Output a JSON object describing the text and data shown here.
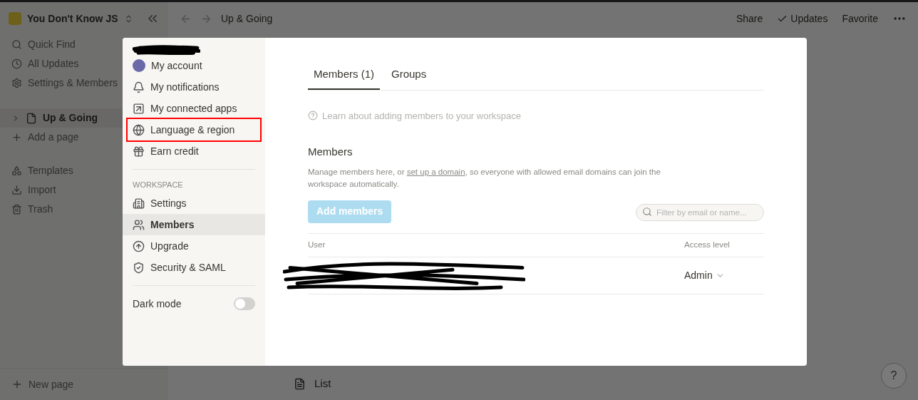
{
  "workspace": {
    "name": "You Don't Know JS"
  },
  "sidebar": {
    "nav": [
      {
        "label": "Quick Find"
      },
      {
        "label": "All Updates"
      },
      {
        "label": "Settings & Members"
      }
    ],
    "pages": [
      {
        "label": "Up & Going",
        "selected": true
      },
      {
        "label": "Add a page",
        "selected": false
      }
    ],
    "tools": [
      {
        "label": "Templates"
      },
      {
        "label": "Import"
      },
      {
        "label": "Trash"
      }
    ],
    "new_page": "New page"
  },
  "topbar": {
    "breadcrumb": "Up & Going",
    "actions": [
      {
        "label": "Share",
        "checked": false
      },
      {
        "label": "Updates",
        "checked": true
      },
      {
        "label": "Favorite",
        "checked": false
      }
    ]
  },
  "page": {
    "list_label": "List"
  },
  "settings": {
    "account_items": [
      {
        "label": "My account",
        "highlighted": false
      },
      {
        "label": "My notifications",
        "highlighted": false
      },
      {
        "label": "My connected apps",
        "highlighted": false
      },
      {
        "label": "Language & region",
        "highlighted": true
      },
      {
        "label": "Earn credit",
        "highlighted": false
      }
    ],
    "workspace_label": "WORKSPACE",
    "workspace_items": [
      {
        "label": "Settings",
        "selected": false
      },
      {
        "label": "Members",
        "selected": true
      },
      {
        "label": "Upgrade",
        "selected": false
      },
      {
        "label": "Security & SAML",
        "selected": false
      }
    ],
    "dark_mode": {
      "label": "Dark mode",
      "on": false
    }
  },
  "members": {
    "tabs": [
      {
        "label": "Members (1)",
        "selected": true
      },
      {
        "label": "Groups",
        "selected": false
      }
    ],
    "learn_link": "Learn about adding members to your workspace",
    "heading": "Members",
    "description": {
      "before": "Manage members here, or ",
      "link": "set up a domain",
      "after": ", so everyone with allowed email domains can join the workspace automatically."
    },
    "add_button": "Add members",
    "filter": {
      "placeholder": "Filter by email or name..."
    },
    "table": {
      "columns": [
        "User",
        "Access level"
      ],
      "rows": [
        {
          "access": "Admin"
        }
      ]
    }
  },
  "help_button": "?"
}
